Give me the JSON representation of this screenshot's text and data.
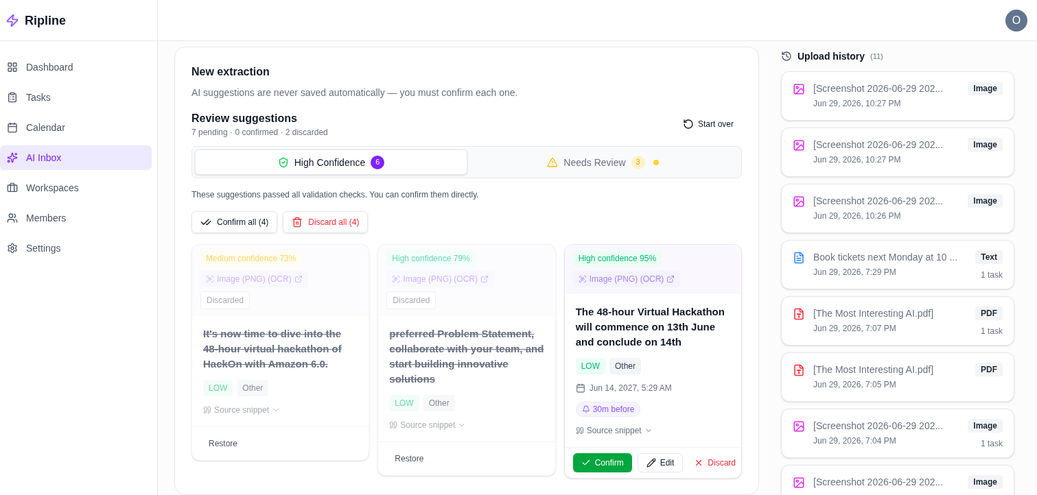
{
  "brand": {
    "name": "Ripline"
  },
  "user": {
    "initial": "O"
  },
  "sidebar": {
    "items": [
      {
        "label": "Dashboard",
        "selected": false
      },
      {
        "label": "Tasks",
        "selected": false
      },
      {
        "label": "Calendar",
        "selected": false
      },
      {
        "label": "AI Inbox",
        "selected": true
      },
      {
        "label": "Workspaces",
        "selected": false
      },
      {
        "label": "Members",
        "selected": false
      },
      {
        "label": "Settings",
        "selected": false
      }
    ]
  },
  "extraction": {
    "title": "New extraction",
    "subtitle": "AI suggestions are never saved automatically — you must confirm each one."
  },
  "review": {
    "title": "Review suggestions",
    "summary": "7 pending · 0 confirmed · 2 discarded",
    "start_over": "Start over",
    "tabs": [
      {
        "kind": "high",
        "label": "High Confidence",
        "count": "6",
        "selected": true,
        "alert": false
      },
      {
        "kind": "review",
        "label": "Needs Review",
        "count": "3",
        "selected": false,
        "alert": true
      }
    ],
    "hint": "These suggestions passed all validation checks. You can confirm them directly.",
    "confirm_all": "Confirm all (4)",
    "discard_all": "Discard all (4)",
    "cards": [
      {
        "kind": "medium",
        "confidence_label": "Medium confidence 73%",
        "source": "Image (PNG) (OCR)",
        "status": "Discarded",
        "discarded": true,
        "title": "It's now time to dive into the 48-hour virtual hackathon of HackOn with Amazon 6.0.",
        "priority": "LOW",
        "category": "Other",
        "snippet": "Source snippet",
        "restore": "Restore"
      },
      {
        "kind": "high",
        "confidence_label": "High confidence 79%",
        "source": "Image (PNG) (OCR)",
        "status": "Discarded",
        "discarded": true,
        "title": "preferred Problem Statement, collaborate with your team, and start building innovative solutions",
        "priority": "LOW",
        "category": "Other",
        "snippet": "Source snippet",
        "restore": "Restore"
      },
      {
        "kind": "high",
        "confidence_label": "High confidence 95%",
        "source": "Image (PNG) (OCR)",
        "discarded": false,
        "title": "The 48-hour Virtual Hackathon will commence on 13th June and conclude on 14th",
        "priority": "LOW",
        "category": "Other",
        "date": "Jun 14, 2027, 5:29 AM",
        "reminder": "30m before",
        "snippet": "Source snippet",
        "confirm": "Confirm",
        "edit": "Edit",
        "discard": "Discard"
      }
    ]
  },
  "history": {
    "title": "Upload history",
    "count": "(11)",
    "items": [
      {
        "kind": "image",
        "title": "[Screenshot 2026-06-29 202...",
        "time": "Jun 29, 2026, 10:27 PM",
        "type": "Image"
      },
      {
        "kind": "image",
        "title": "[Screenshot 2026-06-29 202...",
        "time": "Jun 29, 2026, 10:27 PM",
        "type": "Image"
      },
      {
        "kind": "image",
        "title": "[Screenshot 2026-06-29 202...",
        "time": "Jun 29, 2026, 10:26 PM",
        "type": "Image"
      },
      {
        "kind": "text",
        "title": "Book tickets next Monday at 10 ...",
        "time": "Jun 29, 2026, 7:29 PM",
        "type": "Text",
        "tasks": "1 task"
      },
      {
        "kind": "pdf",
        "title": "[The Most Interesting AI.pdf]",
        "time": "Jun 29, 2026, 7:07 PM",
        "type": "PDF",
        "tasks": "1 task"
      },
      {
        "kind": "pdf",
        "title": "[The Most Interesting AI.pdf]",
        "time": "Jun 29, 2026, 7:05 PM",
        "type": "PDF"
      },
      {
        "kind": "image",
        "title": "[Screenshot 2026-06-29 202...",
        "time": "Jun 29, 2026, 7:04 PM",
        "type": "Image",
        "tasks": "1 task"
      },
      {
        "kind": "image",
        "title": "[Screenshot 2026-06-29 202...",
        "type": "Image"
      }
    ]
  }
}
